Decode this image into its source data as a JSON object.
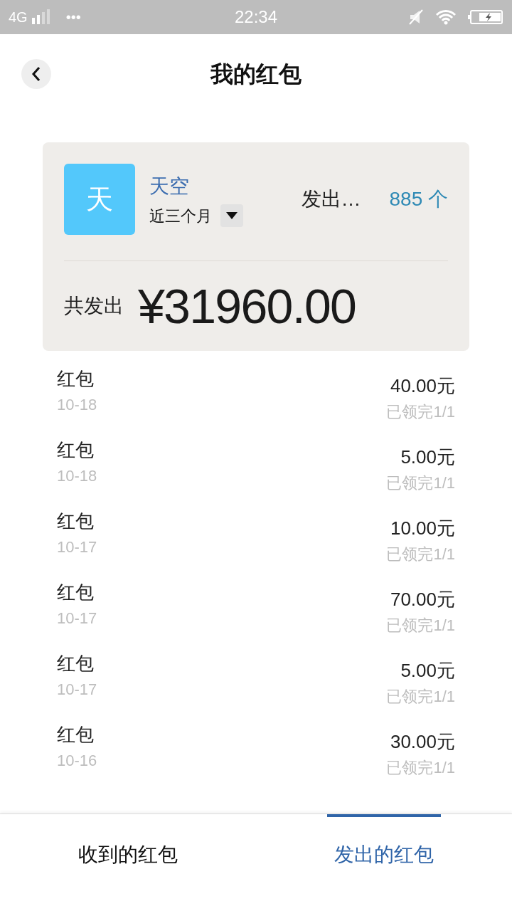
{
  "status_bar": {
    "network": "4G",
    "dots": "•••",
    "time": "22:34"
  },
  "header": {
    "title": "我的红包"
  },
  "summary": {
    "avatar_letter": "天",
    "name": "天空",
    "period": "近三个月",
    "sent_label": "发出…",
    "count": "885 个",
    "total_label": "共发出",
    "total": "¥31960.00"
  },
  "records": [
    {
      "title": "红包",
      "date": "10-18",
      "amount": "40.00元",
      "status": "已领完1/1"
    },
    {
      "title": "红包",
      "date": "10-18",
      "amount": "5.00元",
      "status": "已领完1/1"
    },
    {
      "title": "红包",
      "date": "10-17",
      "amount": "10.00元",
      "status": "已领完1/1"
    },
    {
      "title": "红包",
      "date": "10-17",
      "amount": "70.00元",
      "status": "已领完1/1"
    },
    {
      "title": "红包",
      "date": "10-17",
      "amount": "5.00元",
      "status": "已领完1/1"
    },
    {
      "title": "红包",
      "date": "10-16",
      "amount": "30.00元",
      "status": "已领完1/1"
    }
  ],
  "tabs": [
    {
      "label": "收到的红包",
      "selected": false
    },
    {
      "label": "发出的红包",
      "selected": true
    }
  ]
}
